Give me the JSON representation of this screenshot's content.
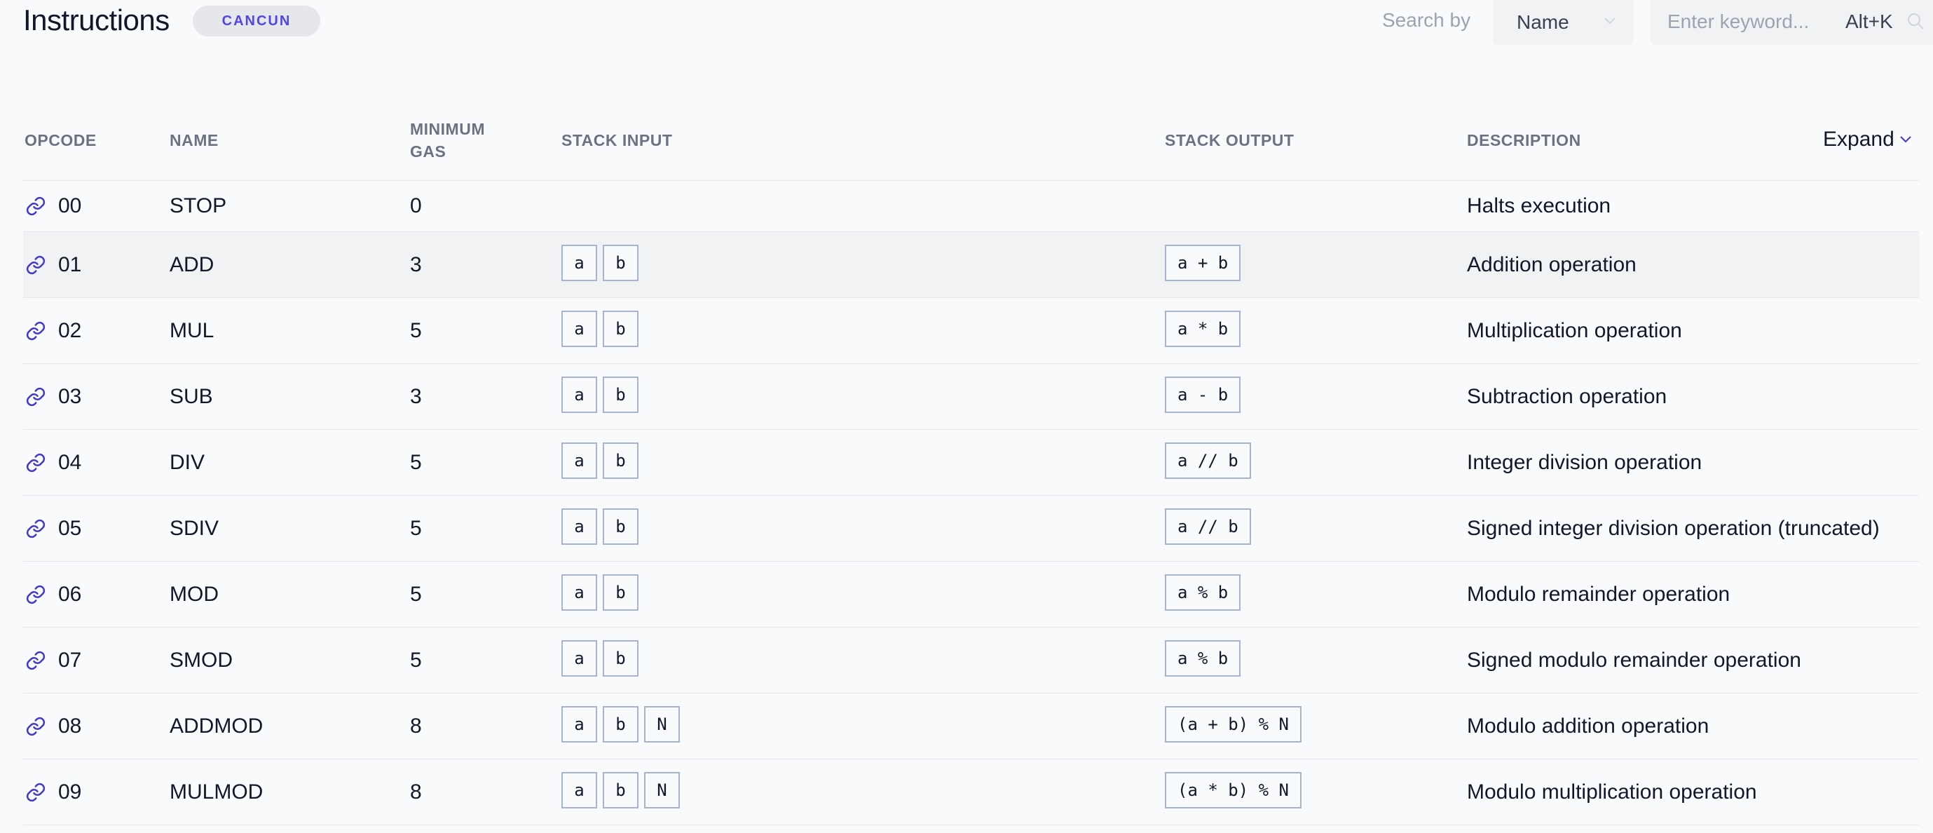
{
  "header": {
    "title": "Instructions",
    "badge": "CANCUN",
    "search_by_label": "Search by",
    "search_by_value": "Name",
    "search_placeholder": "Enter keyword...",
    "search_shortcut": "Alt+K"
  },
  "table": {
    "columns": {
      "opcode": "OPCODE",
      "name": "NAME",
      "min_gas": "MINIMUM GAS",
      "stack_input": "STACK INPUT",
      "stack_output": "STACK OUTPUT",
      "description": "DESCRIPTION"
    },
    "expand_label": "Expand",
    "rows": [
      {
        "opcode": "00",
        "name": "STOP",
        "gas": "0",
        "inputs": [],
        "output": "",
        "desc": "Halts execution"
      },
      {
        "opcode": "01",
        "name": "ADD",
        "gas": "3",
        "inputs": [
          "a",
          "b"
        ],
        "output": "a + b",
        "desc": "Addition operation"
      },
      {
        "opcode": "02",
        "name": "MUL",
        "gas": "5",
        "inputs": [
          "a",
          "b"
        ],
        "output": "a * b",
        "desc": "Multiplication operation"
      },
      {
        "opcode": "03",
        "name": "SUB",
        "gas": "3",
        "inputs": [
          "a",
          "b"
        ],
        "output": "a - b",
        "desc": "Subtraction operation"
      },
      {
        "opcode": "04",
        "name": "DIV",
        "gas": "5",
        "inputs": [
          "a",
          "b"
        ],
        "output": "a // b",
        "desc": "Integer division operation"
      },
      {
        "opcode": "05",
        "name": "SDIV",
        "gas": "5",
        "inputs": [
          "a",
          "b"
        ],
        "output": "a // b",
        "desc": "Signed integer division operation (truncated)"
      },
      {
        "opcode": "06",
        "name": "MOD",
        "gas": "5",
        "inputs": [
          "a",
          "b"
        ],
        "output": "a % b",
        "desc": "Modulo remainder operation"
      },
      {
        "opcode": "07",
        "name": "SMOD",
        "gas": "5",
        "inputs": [
          "a",
          "b"
        ],
        "output": "a % b",
        "desc": "Signed modulo remainder operation"
      },
      {
        "opcode": "08",
        "name": "ADDMOD",
        "gas": "8",
        "inputs": [
          "a",
          "b",
          "N"
        ],
        "output": "(a + b) % N",
        "desc": "Modulo addition operation"
      },
      {
        "opcode": "09",
        "name": "MULMOD",
        "gas": "8",
        "inputs": [
          "a",
          "b",
          "N"
        ],
        "output": "(a * b) % N",
        "desc": "Modulo multiplication operation"
      }
    ]
  },
  "icons": {
    "row_link": "link-icon",
    "select": "chevron-down-icon",
    "search": "search-icon",
    "expand": "chevron-down-icon"
  },
  "colors": {
    "accent": "#4338ca",
    "chip_border": "#a5b4cf",
    "badge_bg": "#e5e7eb"
  }
}
